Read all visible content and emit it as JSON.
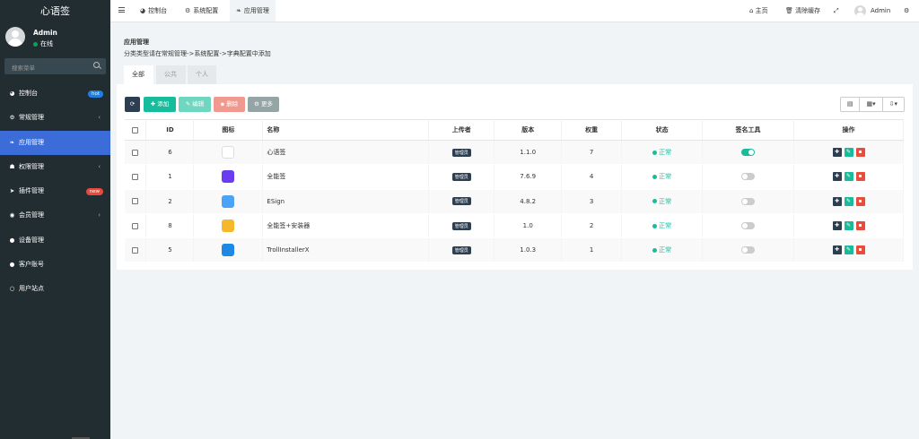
{
  "app": {
    "logo": "心语签"
  },
  "user": {
    "name": "Admin",
    "status": "在线"
  },
  "search": {
    "placeholder": "搜索菜单"
  },
  "sidebar": {
    "items": [
      {
        "label": "控制台",
        "icon": "dashboard-icon",
        "glyph": "◕",
        "badge": "hot"
      },
      {
        "label": "常规管理",
        "icon": "cogs-icon",
        "glyph": "⚙",
        "arrow": "‹"
      },
      {
        "label": "应用管理",
        "icon": "leaf-icon",
        "glyph": "❧",
        "active": true
      },
      {
        "label": "权限管理",
        "icon": "group-icon",
        "glyph": "☗",
        "arrow": "‹"
      },
      {
        "label": "插件管理",
        "icon": "rocket-icon",
        "glyph": "➤",
        "badge": "new"
      },
      {
        "label": "会员管理",
        "icon": "user-circle-icon",
        "glyph": "◉",
        "arrow": "‹"
      },
      {
        "label": "设备管理",
        "icon": "device-icon",
        "glyph": "●"
      },
      {
        "label": "客户账号",
        "icon": "account-icon",
        "glyph": "●"
      },
      {
        "label": "用户站点",
        "icon": "site-icon",
        "glyph": "○"
      }
    ]
  },
  "navbar": {
    "tabs": [
      {
        "label": "控制台",
        "glyph": "◕"
      },
      {
        "label": "系统配置",
        "glyph": "⚙"
      },
      {
        "label": "应用管理",
        "glyph": "❧"
      }
    ],
    "home": "主页",
    "clear_cache": "清除缓存",
    "admin": "Admin"
  },
  "content": {
    "title": "应用管理",
    "desc": "分类类型请在常规管理->系统配置->字典配置中添加",
    "subtabs": [
      "全部",
      "公共",
      "个人"
    ]
  },
  "toolbar": {
    "add": "添加",
    "edit": "编辑",
    "delete": "删除",
    "more": "更多"
  },
  "table": {
    "headers": [
      "ID",
      "图标",
      "名称",
      "上传者",
      "版本",
      "权重",
      "状态",
      "签名工具",
      "操作"
    ],
    "rows": [
      {
        "id": "6",
        "name": "心语签",
        "uploader": "管理员",
        "version": "1.1.0",
        "weight": "7",
        "status": "正常",
        "sign_tool": "on",
        "icon": "penguin-app-icon",
        "icon_color": "#ffffff"
      },
      {
        "id": "1",
        "name": "全能签",
        "uploader": "管理员",
        "version": "7.6.9",
        "weight": "4",
        "status": "正常",
        "sign_tool": "off",
        "icon": "allsign-app-icon",
        "icon_color": "#6a3df0"
      },
      {
        "id": "2",
        "name": "ESign",
        "uploader": "管理员",
        "version": "4.8.2",
        "weight": "3",
        "status": "正常",
        "sign_tool": "off",
        "icon": "esign-app-icon",
        "icon_color": "#4aa3f5"
      },
      {
        "id": "8",
        "name": "全能签+安装器",
        "uploader": "管理员",
        "version": "1.0",
        "weight": "2",
        "status": "正常",
        "sign_tool": "off",
        "icon": "installer-app-icon",
        "icon_color": "#f5b82a"
      },
      {
        "id": "5",
        "name": "TrollInstallerX",
        "uploader": "管理员",
        "version": "1.0.3",
        "weight": "1",
        "status": "正常",
        "sign_tool": "off",
        "icon": "troll-app-icon",
        "icon_color": "#1e88e5"
      }
    ]
  },
  "colors": {
    "sidebar": "#222d32",
    "active": "#3c6cd7",
    "success": "#18bc9c",
    "dark": "#2c3e50",
    "danger": "#e74c3c"
  }
}
